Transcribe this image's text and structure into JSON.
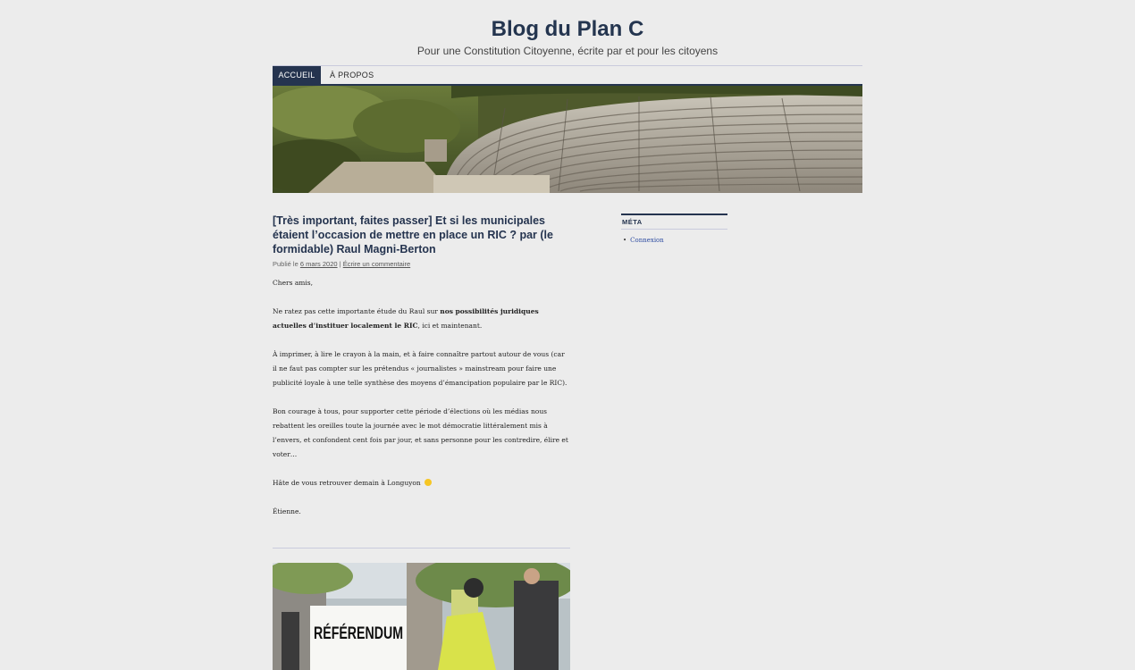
{
  "site": {
    "title": "Blog du Plan C",
    "description": "Pour une Constitution Citoyenne, écrite par et pour les citoyens"
  },
  "nav": {
    "home": "ACCUEIL",
    "about": "À PROPOS"
  },
  "post": {
    "title": "[Très important, faites passer] Et si les municipales étaient l’occasion de mettre en place un RIC ? par (le formidable) Raul Magni-Berton",
    "meta_prefix": "Publié le",
    "date": "6 mars 2020",
    "meta_separator": "|",
    "comment_link": "Écrire un commentaire",
    "p1": "Chers amis,",
    "p2_before": "Ne ratez pas cette importante étude du Raul sur ",
    "p2_bold": "nos possibilités juridiques actuelles d’instituer localement le RIC",
    "p2_after": ", ici et maintenant.",
    "p3": "À imprimer, à lire le crayon à la main, et à faire connaître partout autour de vous (car il ne faut pas compter sur les prétendus « journalistes » mainstream pour faire une publicité loyale à une telle synthèse des moyens d’émancipation populaire par le RIC).",
    "p4": "Bon courage à tous, pour supporter cette période d’élections où les médias nous rebattent les oreilles toute la journée avec le mot démocratie littéralement mis à l’envers, et confondent cent fois par jour, et sans personne pour les contredire, élire et voter…",
    "p5": "Hâte de vous retrouver demain à Longuyon",
    "p6": "Étienne.",
    "image_sign_text": "RÉFÉRENDUM"
  },
  "sidebar": {
    "meta_title": "MÉTA",
    "login": "Connexion"
  },
  "colors": {
    "accent": "#25344f",
    "background": "#ececec",
    "link": "#2b4aa0"
  }
}
